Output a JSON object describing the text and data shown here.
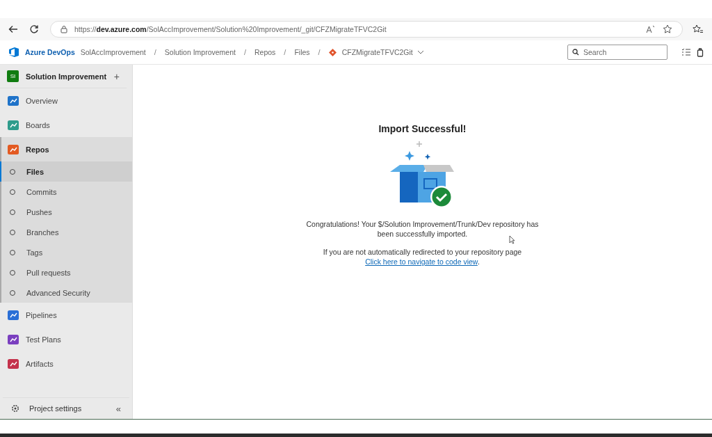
{
  "browser": {
    "url": "https://**dev.azure.com**/SolAccImprovement/Solution%20Improvement/_git/CFZMigrateTFVC2Git"
  },
  "header": {
    "brand": "Azure DevOps",
    "breadcrumbs": [
      "SolAccImprovement",
      "Solution Improvement",
      "Repos",
      "Files"
    ],
    "separator": "/",
    "repo": "CFZMigrateTFVC2Git",
    "search": {
      "placeholder": "Search"
    }
  },
  "sidebar": {
    "project": {
      "initials": "SI",
      "name": "Solution Improvement",
      "add": "+"
    },
    "items": [
      {
        "label": "Overview",
        "selected": false
      },
      {
        "label": "Boards",
        "selected": false
      },
      {
        "label": "Repos",
        "selected": false,
        "expanded": true,
        "children": [
          {
            "label": "Files",
            "selected": true
          },
          {
            "label": "Commits",
            "selected": false
          },
          {
            "label": "Pushes",
            "selected": false
          },
          {
            "label": "Branches",
            "selected": false
          },
          {
            "label": "Tags",
            "selected": false
          },
          {
            "label": "Pull requests",
            "selected": false
          },
          {
            "label": "Advanced Security",
            "selected": false
          }
        ]
      },
      {
        "label": "Pipelines",
        "selected": false
      },
      {
        "label": "Test Plans",
        "selected": false
      },
      {
        "label": "Artifacts",
        "selected": false
      }
    ],
    "settings": "Project settings",
    "collapse": "«"
  },
  "main": {
    "title": "Import Successful!",
    "message": "Congratulations! Your $/Solution Improvement/Trunk/Dev repository has been successfully imported.",
    "redirect": "If you are not automatically redirected to your repository page",
    "link": "Click here to navigate to code view",
    "after_link": "."
  }
}
